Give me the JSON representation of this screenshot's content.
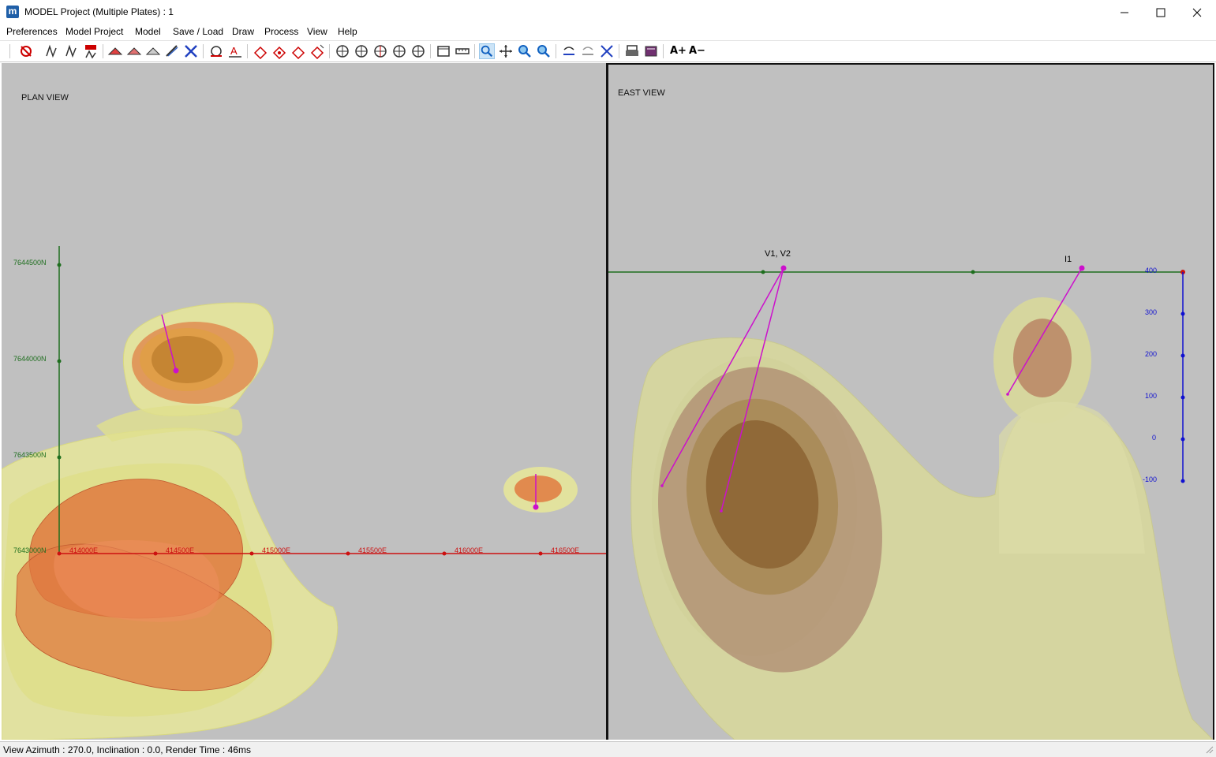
{
  "window": {
    "title": "MODEL Project (Multiple Plates) : 1",
    "app_icon_letter": "m"
  },
  "menu": [
    "Preferences",
    "Model Project",
    "Model",
    "Save / Load",
    "Draw",
    "Process",
    "View",
    "Help"
  ],
  "toolbar": {
    "font_larger": "A+",
    "font_smaller": "A−"
  },
  "plan_view": {
    "label": "PLAN VIEW",
    "northing_labels": [
      "7644500N",
      "7644000N",
      "7643500N",
      "7643000N"
    ],
    "easting_labels": [
      "414000E",
      "414500E",
      "415000E",
      "415500E",
      "416000E",
      "416500E"
    ]
  },
  "east_view": {
    "label": "EAST VIEW",
    "elevation_labels": [
      "400",
      "300",
      "200",
      "100",
      "0",
      "-100"
    ],
    "plate_labels": [
      "V1, V2",
      "I1"
    ]
  },
  "status": {
    "text": "View Azimuth : 270.0, Inclination : 0.0, Render Time : 46ms"
  },
  "colors": {
    "plan_axis_north": "#1e6e1e",
    "plan_axis_east": "#cc1010",
    "elevation_axis": "#1010d0",
    "plate_trace": "#cc10cc",
    "viewport_bg": "#c0c0c0"
  }
}
